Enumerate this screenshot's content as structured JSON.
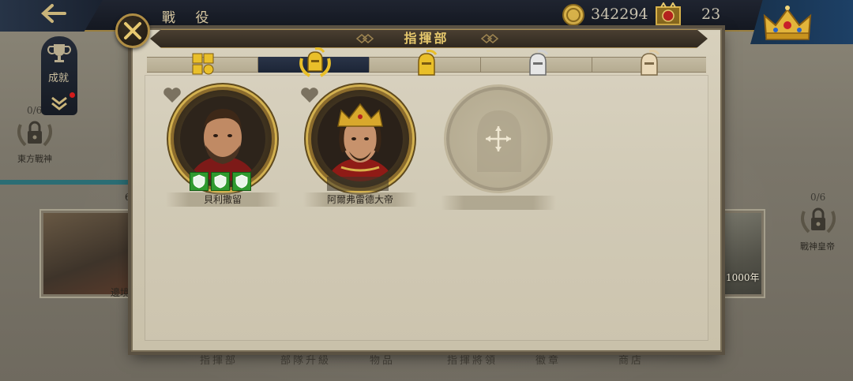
{
  "topbar": {
    "screen_title": "戰 役",
    "coins": "342294",
    "emblems": "23",
    "icons": [
      "back-arrow-icon",
      "gold-coin-icon",
      "emblem-icon",
      "crown-icon"
    ]
  },
  "left": {
    "achievement_label": "成就",
    "east_progress": "0/6",
    "east_name": "東方戰神",
    "stage_left_label": "邊境",
    "stage_left_num": "6"
  },
  "right": {
    "emperor_progress": "0/6",
    "emperor_name": "戰神皇帝",
    "stage_year": "1000年"
  },
  "bottom_nav": [
    "指揮部",
    "部隊升級",
    "物品",
    "指揮將領",
    "徽章",
    "商店"
  ],
  "modal": {
    "title": "指揮部",
    "tabs": [
      {
        "icon": "grid-icon",
        "active": false
      },
      {
        "icon": "gold-laurel-helmet-icon",
        "active": true
      },
      {
        "icon": "gold-helmet-icon",
        "active": false
      },
      {
        "icon": "silver-helmet-icon",
        "active": false
      },
      {
        "icon": "bronze-helmet-icon",
        "active": false
      }
    ],
    "heroes": [
      {
        "name": "貝利撒留",
        "shields": 3
      },
      {
        "name": "阿爾弗雷德大帝",
        "shields": 0
      }
    ],
    "empty_slot_name": ""
  },
  "colors": {
    "accent_gold": "#e6c86d",
    "active_tab": "#1c2536",
    "shield_green": "#2f9a2f"
  }
}
